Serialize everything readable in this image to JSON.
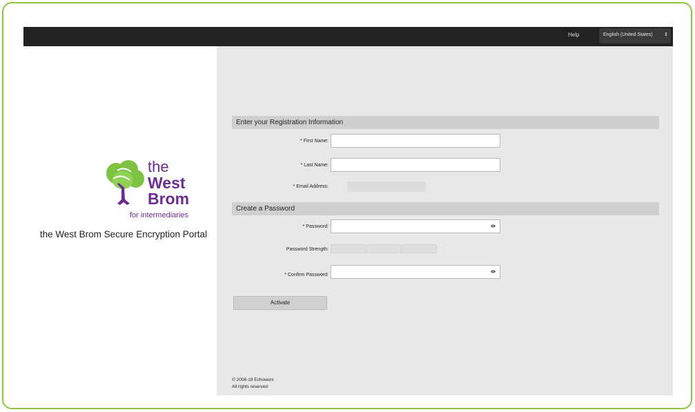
{
  "topbar": {
    "help_label": "Help",
    "language_selected": "English (United States)"
  },
  "branding": {
    "logo_the": "the",
    "logo_west": "West",
    "logo_brom": "Brom",
    "logo_subtitle": "for intermediaries",
    "portal_title": "the West Brom Secure Encryption Portal",
    "logo_purple": "#6d2c91",
    "logo_green": "#7dc242"
  },
  "registration": {
    "header": "Enter your Registration Information",
    "first_name_label": "* First Name:",
    "last_name_label": "* Last Name:",
    "email_label": "* Email Address:",
    "first_name_value": "",
    "last_name_value": ""
  },
  "password": {
    "header": "Create a Password",
    "password_label": "* Password:",
    "strength_label": "Password Strength:",
    "confirm_label": "* Confirm Password:"
  },
  "actions": {
    "activate_label": "Activate"
  },
  "footer": {
    "copyright": "© 2008-18 Echoworx",
    "rights": "All rights reserved"
  },
  "colors": {
    "frame_border": "#8dc63f",
    "topbar_bg": "#222222",
    "panel_bg": "#e8e8e8",
    "section_header_bg": "#cfcfcf"
  },
  "icons": {
    "password_toggle": "eye-icon",
    "language_toggle": "updown-arrows-icon"
  }
}
